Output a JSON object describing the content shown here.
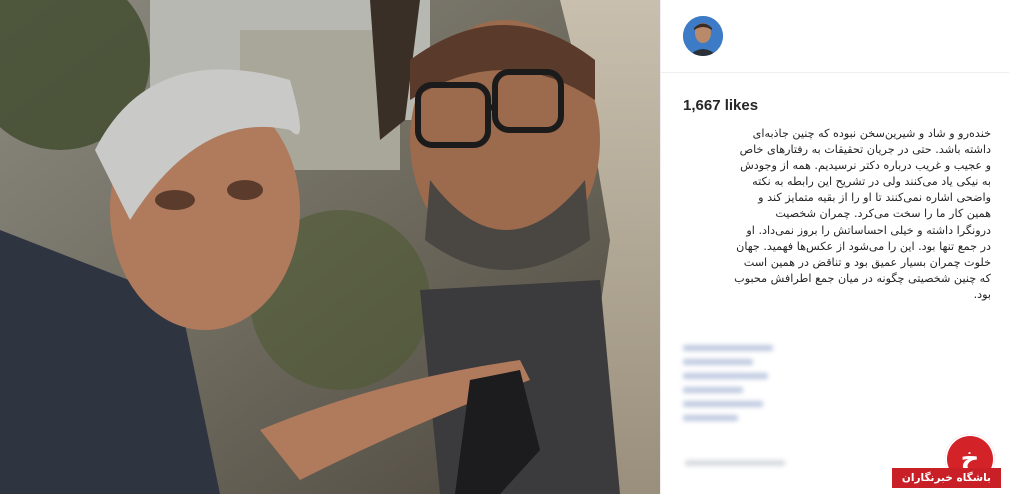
{
  "post": {
    "likes": "1,667 likes",
    "caption": "خندەرو و شاد و شیرین‌سخن نبوده که چنین جاذبه‌ای\nداشته باشد. حتی در جریان تحقیقات به رفتارهای خاص\nو عجیب و غریب درباره دکتر نرسیدیم. همه از وجودش\nبه نیکی یاد می‌کنند ولی در تشریح این رابطه به نکته\nواضحی اشاره نمی‌کنند تا او را از بقیه متمایز کند و\nهمین کار ما را سخت می‌کرد. چمران شخصیت\nدرونگرا داشته و خیلی احساساتش را بروز نمی‌داد. او\nدر جمع تنها بود. این را می‌شود از عکس‌ها فهمید. جهان\nخلوت چمران بسیار عمیق بود و تناقض در همین است\nکه چنین شخصیتی چگونه در میان جمع اطرافش محبوب\nبود."
  },
  "icons": {
    "avatar": "profile-avatar",
    "watermark": "site-logo"
  },
  "watermark": {
    "glyph": "خ",
    "label": "باشگاه خبرنگاران"
  },
  "colors": {
    "brand_red": "#c91f26",
    "text": "#262626",
    "divider": "#efefef"
  }
}
